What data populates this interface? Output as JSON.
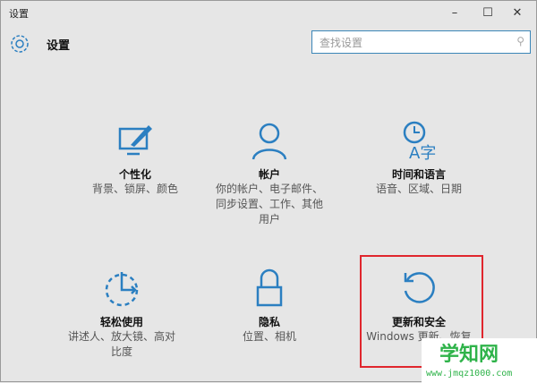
{
  "window": {
    "title": "设置",
    "minimize": "–",
    "maximize": "☐",
    "close": "✕"
  },
  "header": {
    "title": "设置",
    "search_placeholder": "查找设置",
    "search_icon": "search-icon"
  },
  "tiles": [
    {
      "name": "个性化",
      "desc": "背景、锁屏、颜色",
      "icon": "personalization-icon"
    },
    {
      "name": "帐户",
      "desc": "你的帐户、电子邮件、同步设置、工作、其他用户",
      "icon": "account-icon"
    },
    {
      "name": "时间和语言",
      "desc": "语音、区域、日期",
      "icon": "time-language-icon"
    },
    {
      "name": "轻松使用",
      "desc": "讲述人、放大镜、高对比度",
      "icon": "ease-of-access-icon"
    },
    {
      "name": "隐私",
      "desc": "位置、相机",
      "icon": "lock-icon"
    },
    {
      "name": "更新和安全",
      "desc": "Windows 更新、恢复",
      "icon": "update-icon"
    }
  ],
  "watermark": {
    "title": "学知网",
    "url": "www.jmqz1000.com"
  },
  "accent": "#2b7fc1"
}
